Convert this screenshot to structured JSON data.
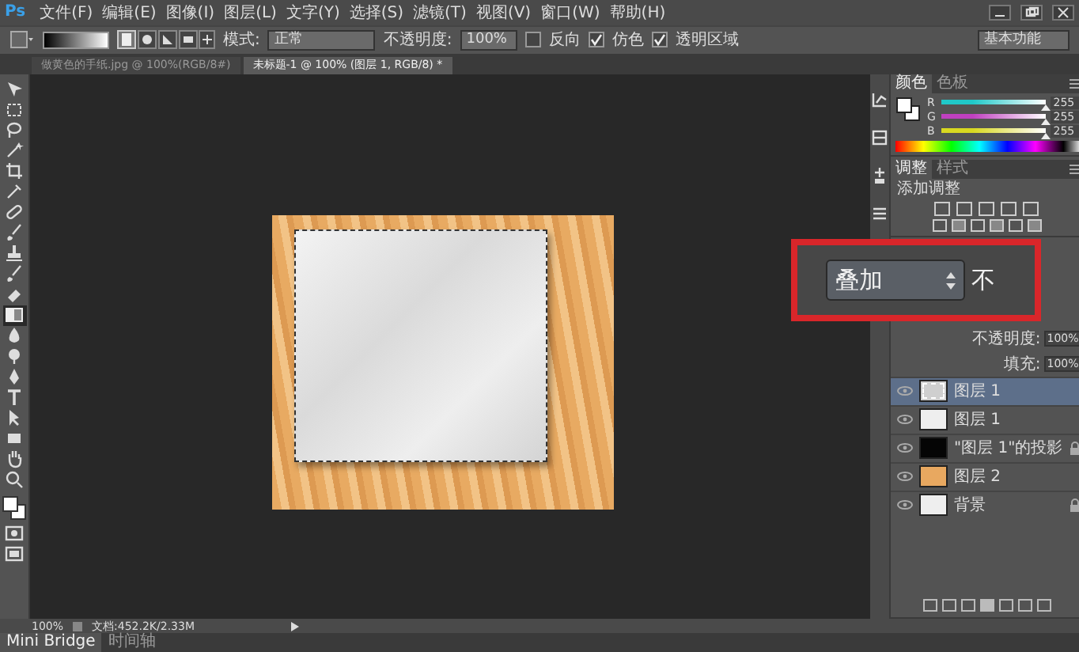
{
  "menu_bar": {
    "logo": "Ps",
    "items": [
      "文件(F)",
      "编辑(E)",
      "图像(I)",
      "图层(L)",
      "文字(Y)",
      "选择(S)",
      "滤镜(T)",
      "视图(V)",
      "窗口(W)",
      "帮助(H)"
    ]
  },
  "options_bar": {
    "mode_label": "模式:",
    "mode": "正常",
    "opacity_label": "不透明度:",
    "opacity": "100%",
    "checkboxes": [
      {
        "label": "反向",
        "checked": false
      },
      {
        "label": "仿色",
        "checked": true
      },
      {
        "label": "透明区域",
        "checked": true
      }
    ],
    "workspace": "基本功能"
  },
  "document_tabs": [
    {
      "label": "做黄色的手纸.jpg @ 100%(RGB/8#)",
      "selected": false
    },
    {
      "label": "未标题-1 @ 100% (图层 1, RGB/8) *",
      "selected": true
    }
  ],
  "tools": [
    {
      "kind": "move",
      "selected": false
    },
    {
      "kind": "marquee",
      "selected": false
    },
    {
      "kind": "lasso",
      "selected": false
    },
    {
      "kind": "wand",
      "selected": false
    },
    {
      "kind": "crop",
      "selected": false
    },
    {
      "kind": "eyedropper",
      "selected": false
    },
    {
      "kind": "bandage",
      "selected": false
    },
    {
      "kind": "brush",
      "selected": false
    },
    {
      "kind": "stamp",
      "selected": false
    },
    {
      "kind": "brush",
      "selected": false
    },
    {
      "kind": "eraser",
      "selected": false
    },
    {
      "kind": "gradient",
      "selected": true
    },
    {
      "kind": "drop",
      "selected": false
    },
    {
      "kind": "dodge",
      "selected": false
    },
    {
      "kind": "pen",
      "selected": false
    },
    {
      "kind": "type",
      "selected": false
    },
    {
      "kind": "arrow",
      "selected": false
    },
    {
      "kind": "rect",
      "selected": false
    },
    {
      "kind": "hand",
      "selected": false
    },
    {
      "kind": "zoom",
      "selected": false
    }
  ],
  "color_panel": {
    "tabs": [
      {
        "label": "颜色",
        "selected": true
      },
      {
        "label": "色板",
        "selected": false
      }
    ],
    "channels": [
      {
        "name": "R",
        "value": "255",
        "level": 1,
        "color": "#20c8c8"
      },
      {
        "name": "G",
        "value": "255",
        "level": 1,
        "color": "#c040c0"
      },
      {
        "name": "B",
        "value": "255",
        "level": 1,
        "color": "#d8d820"
      }
    ]
  },
  "adjustments_panel": {
    "tabs": [
      {
        "label": "调整",
        "selected": true
      },
      {
        "label": "样式",
        "selected": false
      }
    ],
    "title": "添加调整"
  },
  "callout": {
    "blend_mode": "叠加",
    "cut_label": "不"
  },
  "layers_panel": {
    "opacity_label": "不透明度:",
    "opacity": "100%",
    "fill_label": "填充:",
    "fill": "100%",
    "layers": [
      {
        "name": "图层 1",
        "kind": "paper",
        "selected": true,
        "locked": false
      },
      {
        "name": "图层 1",
        "kind": "white",
        "selected": false,
        "locked": false
      },
      {
        "name": "\"图层 1\"的投影",
        "kind": "black",
        "selected": false,
        "locked": true
      },
      {
        "name": "图层 2",
        "kind": "orange",
        "selected": false,
        "locked": false
      },
      {
        "name": "背景",
        "kind": "white",
        "selected": false,
        "locked": true
      }
    ]
  },
  "status_bar": {
    "zoom": "100%",
    "doc_info": "文档:452.2K/2.33M"
  },
  "bottom_tabs": [
    {
      "label": "Mini Bridge",
      "selected": true
    },
    {
      "label": "时间轴",
      "selected": false
    }
  ]
}
